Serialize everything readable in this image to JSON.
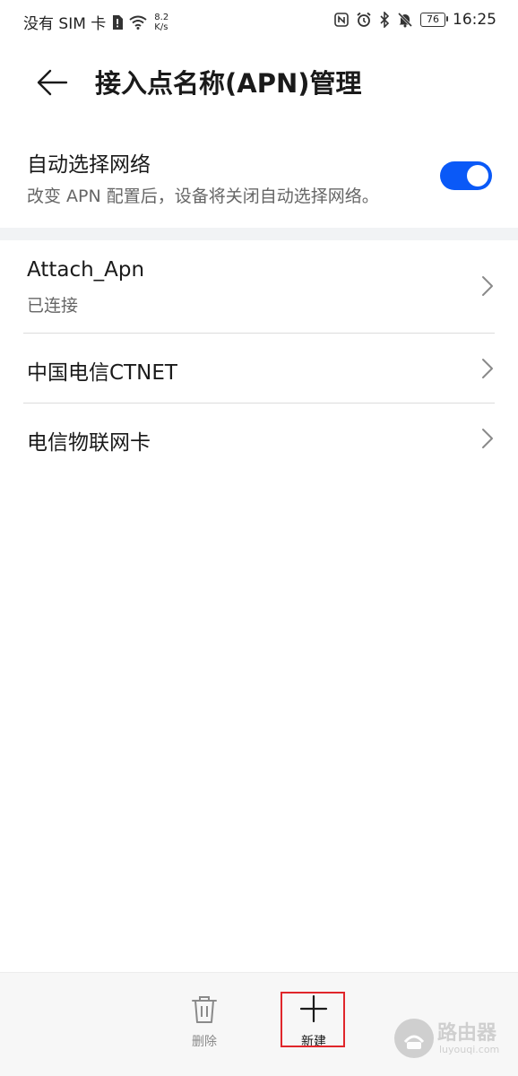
{
  "status_bar": {
    "carrier": "没有 SIM 卡",
    "speed_value": "8.2",
    "speed_unit": "K/s",
    "battery": "76",
    "time": "16:25",
    "icons": [
      "sim-alert-icon",
      "wifi-icon",
      "nfc-icon",
      "alarm-icon",
      "bluetooth-icon",
      "mute-icon",
      "battery-icon"
    ]
  },
  "header": {
    "title": "接入点名称(APN)管理",
    "back_icon": "back-arrow-icon"
  },
  "auto_select": {
    "title": "自动选择网络",
    "subtitle": "改变 APN 配置后，设备将关闭自动选择网络。",
    "enabled": true,
    "accent_color": "#0a59f7"
  },
  "apn_list": [
    {
      "name": "Attach_Apn",
      "status": "已连接"
    },
    {
      "name": "中国电信CTNET"
    },
    {
      "name": "电信物联网卡"
    }
  ],
  "toolbar": {
    "delete_label": "删除",
    "new_label": "新建"
  },
  "watermark": {
    "text": "路由器",
    "sub": "luyouqi.com"
  },
  "colors": {
    "highlight": "#e0262b",
    "section_gap": "#f1f3f5"
  }
}
